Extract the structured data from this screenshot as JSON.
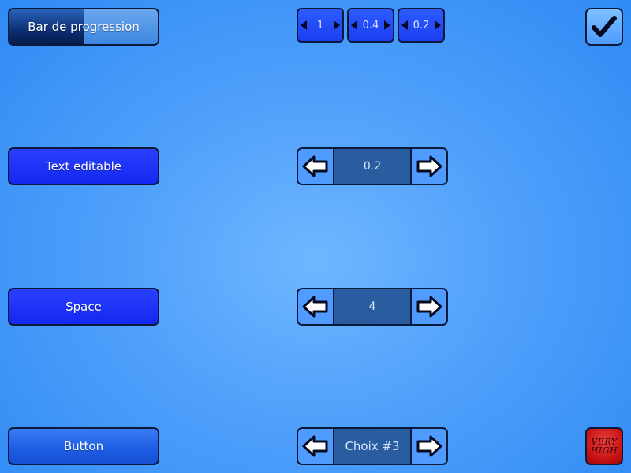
{
  "left_column": {
    "progress_bar": {
      "label": "Bar de progression",
      "progress": 0.5
    },
    "text_editable": {
      "label": "Text editable"
    },
    "space": {
      "label": "Space"
    },
    "button": {
      "label": "Button"
    }
  },
  "top_spinners": [
    {
      "value": "1"
    },
    {
      "value": "0.4"
    },
    {
      "value": "0.2"
    }
  ],
  "spinners": {
    "decimal": {
      "value": "0.2"
    },
    "integer": {
      "value": "4"
    },
    "choice": {
      "value": "Choix #3"
    }
  },
  "checkbox": {
    "checked": true,
    "icon": "check-icon"
  },
  "quality_button": {
    "line1": "VERY",
    "line2": "HIGH"
  },
  "colors": {
    "button_blue": "#1428f0",
    "spinner_field": "#2a5da0",
    "arrow_bg": "#4f9bff",
    "quality_red": "#c41010"
  }
}
